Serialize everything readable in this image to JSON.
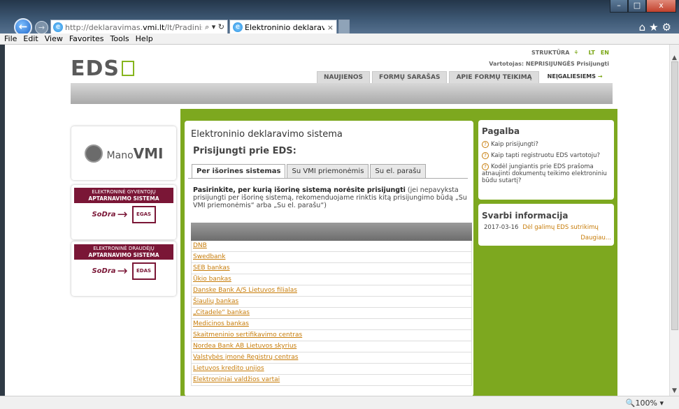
{
  "browser": {
    "address": "http://deklaravimas.vmi.lt/lt/Pradinis_Prisijun",
    "address_domain": "vmi.lt",
    "address_tools": "⌕ ▾ ↻",
    "tab_title": "Elektroninio deklaravimo si...",
    "tab_close": "×",
    "back_glyph": "←",
    "forward_glyph": "→",
    "chrome_icons": "⌂★⚙",
    "window_buttons": [
      "–",
      "□",
      "x"
    ],
    "zoom": "🔍100%  ▾",
    "menu": [
      "File",
      "Edit",
      "View",
      "Favorites",
      "Tools",
      "Help"
    ]
  },
  "site": {
    "logo": "EDS",
    "struktura": "STRUKTŪRA",
    "lang_lt": "LT",
    "lang_en": "EN",
    "user_line": "Vartotojas: NEPRISIJUNGĖS  Prisijungti",
    "nav": [
      "NAUJIENOS",
      "FORMŲ SARAŠAS",
      "APIE FORMŲ TEIKIMĄ"
    ],
    "access_label": "NEĮGALIESIEMS",
    "access_arrow": "→"
  },
  "sidebar": {
    "mano_prefix": "Mano",
    "mano_vmi": "VMI",
    "promo1": {
      "line1": "ELEKTRONINĖ GYVENTOJŲ",
      "line2": "APTARNAVIMO SISTEMA",
      "logo": "SoDra",
      "target": "EGAS"
    },
    "promo2": {
      "line1": "ELEKTRONINĖ DRAUDĖJŲ",
      "line2": "APTARNAVIMO SISTEMA",
      "logo": "SoDra",
      "target": "EDAS"
    }
  },
  "main": {
    "title": "Elektroninio deklaravimo sistema",
    "subtitle": "Prisijungti prie EDS:",
    "tabs": [
      "Per išorines sistemas",
      "Su VMI priemonėmis",
      "Su el. parašu"
    ],
    "desc_bold": "Pasirinkite, per kurią išorinę sistemą norėsite prisijungti",
    "desc_rest": " (jei nepavyksta prisijungti per išorinę sistemą, rekomenduojame rinktis kitą prisijungimo būdą „Su VMI priemonėmis“ arba „Su el. parašu“)",
    "banks": [
      "DNB",
      "Swedbank",
      "SEB bankas",
      "Ūkio bankas",
      "Danske Bank A/S Lietuvos filialas",
      "Šiaulių bankas",
      "„Citadele“ bankas",
      "Medicinos bankas",
      "Skaitmeninio sertifikavimo centras",
      "Nordea Bank AB Lietuvos skyrius",
      "Valstybės įmonė Registrų centras",
      "Lietuvos kredito unijos",
      "Elektroniniai valdžios vartai"
    ]
  },
  "help": {
    "title": "Pagalba",
    "items": [
      "Kaip prisijungti?",
      "Kaip tapti registruotu EDS vartotoju?",
      "Kodėl jungiantis prie EDS prašoma atnaujinti dokumentų teikimo elektroniniu būdu sutartį?"
    ]
  },
  "info": {
    "title": "Svarbi informacija",
    "date": "2017-03-16",
    "link": "Dėl galimų EDS sutrikimų",
    "more": "Daugiau..."
  }
}
